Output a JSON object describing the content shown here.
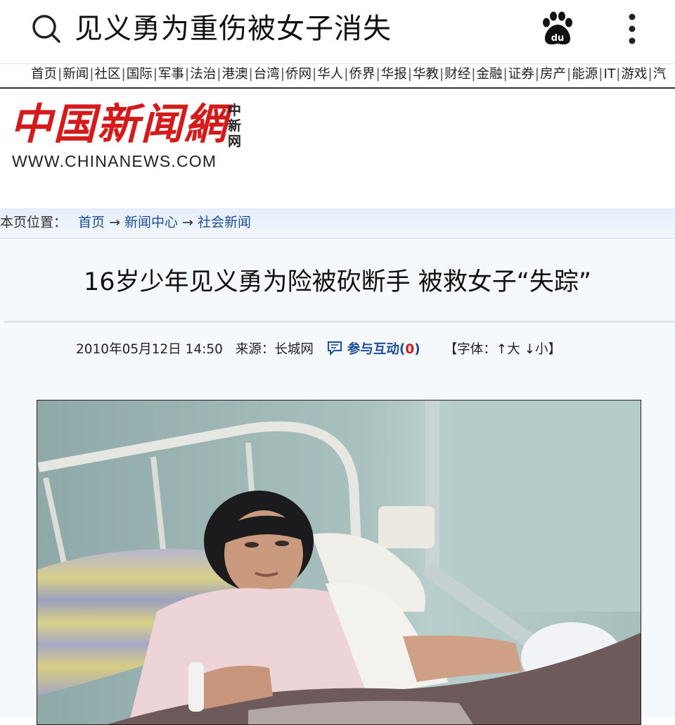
{
  "search": {
    "query": "见义勇为重伤被女子消失"
  },
  "nav": {
    "items": [
      "首页",
      "新闻",
      "社区",
      "国际",
      "军事",
      "法治",
      "港澳",
      "台湾",
      "侨网",
      "华人",
      "侨界",
      "华报",
      "华教",
      "财经",
      "金融",
      "证券",
      "房产",
      "能源",
      "IT",
      "游戏",
      "汽"
    ]
  },
  "logo": {
    "chinese": "中国新闻網",
    "vertical": "中新网",
    "url": "WWW.CHINANEWS.COM"
  },
  "breadcrumb": {
    "label": "本页位置：",
    "home": "首页",
    "center": "新闻中心",
    "section": "社会新闻",
    "arrow": "→"
  },
  "article": {
    "title": "16岁少年见义勇为险被砍断手 被救女子“失踪”",
    "datetime": "2010年05月12日 14:50",
    "source": "来源：长城网",
    "engage_label": "参与互动",
    "engage_count": "0",
    "font_control": "【字体：↑大 ↓小】"
  },
  "colors": {
    "brand_red": "#d41a1a",
    "link_blue": "#1d4f95"
  }
}
